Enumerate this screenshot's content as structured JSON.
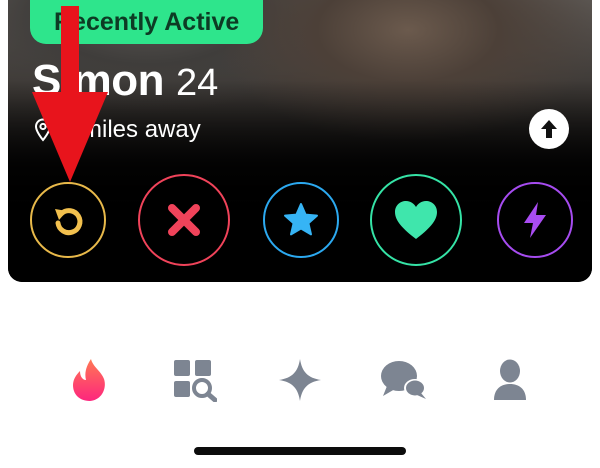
{
  "profile": {
    "badge": "Recently Active",
    "name": "Simon",
    "age": "24",
    "distance": "2 miles away"
  },
  "actions": [
    {
      "icon": "rewind-icon",
      "color": "#e8b94a"
    },
    {
      "icon": "close-icon",
      "color": "#f0435a"
    },
    {
      "icon": "star-icon",
      "color": "#2ca9f0"
    },
    {
      "icon": "heart-icon",
      "color": "#35e3a6"
    },
    {
      "icon": "lightning-icon",
      "color": "#a64cf0"
    }
  ],
  "nav": [
    {
      "icon": "flame-icon",
      "active": true
    },
    {
      "icon": "explore-grid-icon",
      "active": false
    },
    {
      "icon": "sparkle-icon",
      "active": false
    },
    {
      "icon": "chat-icon",
      "active": false
    },
    {
      "icon": "profile-icon",
      "active": false
    }
  ],
  "colors": {
    "badge": "#2ee58c",
    "annotation": "#e8141c",
    "nav_inactive": "#7d8592",
    "brand_gradient_top": "#ff5a5f",
    "brand_gradient_bottom": "#fd267d"
  }
}
